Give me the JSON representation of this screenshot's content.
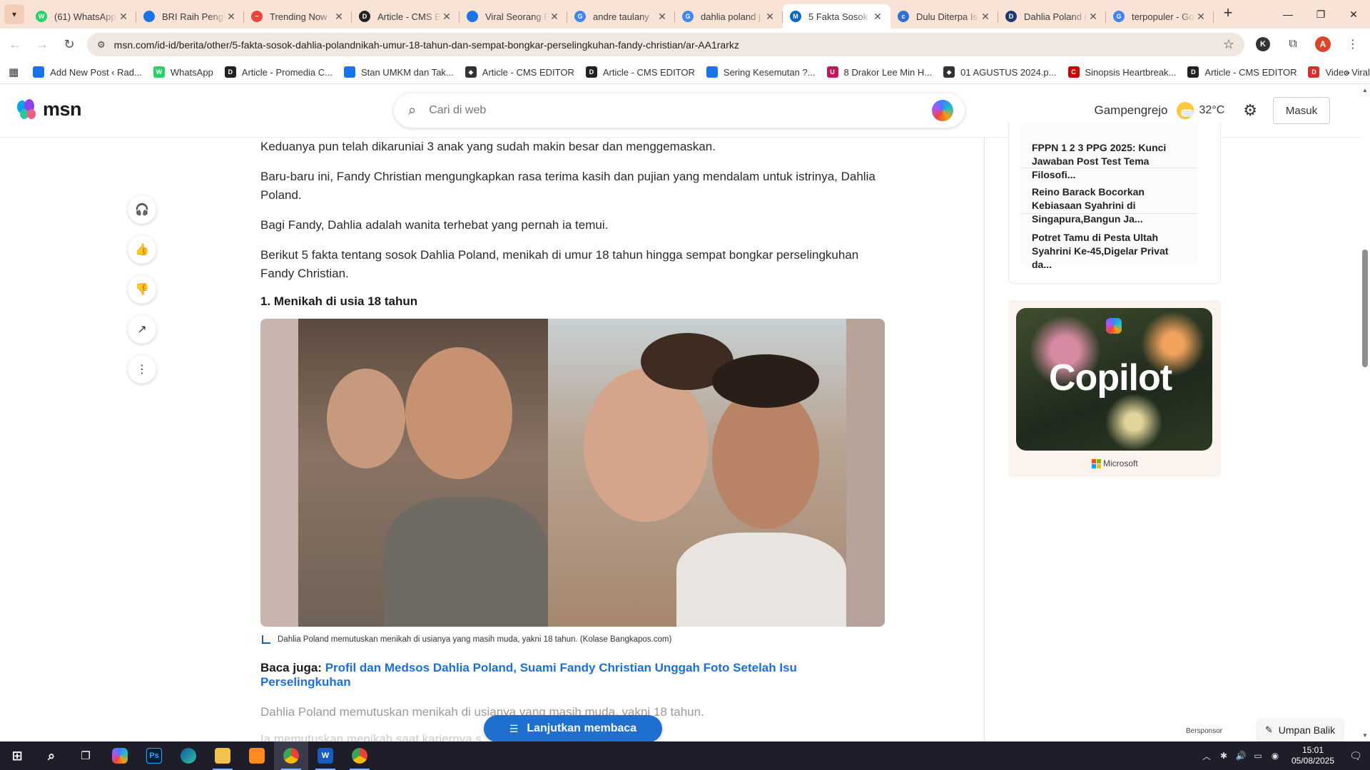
{
  "browser": {
    "tabs": [
      {
        "title": "(61) WhatsApp",
        "icon": "whatsapp-icon",
        "color": "#25d366",
        "glyph": "W"
      },
      {
        "title": "BRI Raih Pengh",
        "icon": "bookmark-icon",
        "color": "#1a73e8",
        "glyph": ""
      },
      {
        "title": "Trending Now",
        "icon": "trending-icon",
        "color": "#e8453c",
        "glyph": "~"
      },
      {
        "title": "Article - CMS E",
        "icon": "cms-icon",
        "color": "#222222",
        "glyph": "D"
      },
      {
        "title": "Viral Seorang P",
        "icon": "bookmark-icon",
        "color": "#1a73e8",
        "glyph": ""
      },
      {
        "title": "andre taulany",
        "icon": "google-icon",
        "color": "#4285f4",
        "glyph": "G"
      },
      {
        "title": "dahlia poland j",
        "icon": "google-icon",
        "color": "#4285f4",
        "glyph": "G"
      },
      {
        "title": "5 Fakta Sosok D",
        "icon": "msn-icon",
        "color": "#0a66c2",
        "glyph": "M"
      },
      {
        "title": "Dulu Diterpa Is",
        "icon": "cloud-icon",
        "color": "#2f6fd6",
        "glyph": "c"
      },
      {
        "title": "Dahlia Poland C",
        "icon": "dahlia-icon",
        "color": "#1c3a6b",
        "glyph": "D"
      },
      {
        "title": "terpopuler - Go",
        "icon": "google-icon",
        "color": "#4285f4",
        "glyph": "G"
      }
    ],
    "active_tab": 7,
    "url": "msn.com/id-id/berita/other/5-fakta-sosok-dahlia-polandnikah-umur-18-tahun-dan-sempat-bongkar-perselingkuhan-fandy-christian/ar-AA1rarkz",
    "profile_initial": "A",
    "extension_initial": "K",
    "bookmarks": [
      {
        "label": "Add New Post ‹ Rad...",
        "color": "#1a73e8",
        "glyph": ""
      },
      {
        "label": "WhatsApp",
        "color": "#25d366",
        "glyph": "W"
      },
      {
        "label": "Article - Promedia C...",
        "color": "#222222",
        "glyph": "D"
      },
      {
        "label": "Stan UMKM dan Tak...",
        "color": "#1a73e8",
        "glyph": ""
      },
      {
        "label": "Article - CMS EDITOR",
        "color": "#333333",
        "glyph": "◆"
      },
      {
        "label": "Article - CMS EDITOR",
        "color": "#222222",
        "glyph": "D"
      },
      {
        "label": "Sering Kesemutan ?...",
        "color": "#1a73e8",
        "glyph": ""
      },
      {
        "label": "8 Drakor Lee Min H...",
        "color": "#c2185b",
        "glyph": "U"
      },
      {
        "label": "01 AGUSTUS 2024.p...",
        "color": "#333333",
        "glyph": "◆"
      },
      {
        "label": "Sinopsis Heartbreak...",
        "color": "#cc0000",
        "glyph": "C"
      },
      {
        "label": "Article - CMS EDITOR",
        "color": "#222222",
        "glyph": "D"
      },
      {
        "label": "Video Viral Erin Bug...",
        "color": "#d32f2f",
        "glyph": "D"
      }
    ]
  },
  "msn": {
    "logo": "msn",
    "search_placeholder": "Cari di web",
    "location": "Gampengrejo",
    "temperature": "32°C",
    "signin_label": "Masuk"
  },
  "article": {
    "paragraphs": [
      "Keduanya pun telah dikaruniai 3 anak yang sudah makin besar dan menggemaskan.",
      "Baru-baru ini, Fandy Christian mengungkapkan rasa terima kasih dan pujian yang mendalam untuk istrinya, Dahlia Poland.",
      "Bagi Fandy, Dahlia adalah wanita terhebat yang pernah ia temui.",
      "Berikut 5 fakta tentang sosok Dahlia Poland, menikah di umur 18 tahun hingga sempat bongkar perselingkuhan Fandy Christian."
    ],
    "heading": "1. Menikah di usia 18 tahun",
    "caption": "Dahlia Poland memutuskan menikah di usianya yang masih muda, yakni 18 tahun. (Kolase Bangkapos.com)",
    "read_also_prefix": "Baca juga:",
    "read_also_link": "Profil dan Medsos Dahlia Poland, Suami Fandy Christian Unggah Foto Setelah Isu Perselingkuhan",
    "muted_paragraph": "Dahlia Poland memutuskan menikah di usianya yang masih muda, yakni 18 tahun.",
    "faded_paragraph": "Ia memutuskan menikah saat kariernya s",
    "continue_label": "Lanjutkan membaca"
  },
  "sidebar": {
    "trending": [
      "FPPN 1 2 3 PPG 2025: Kunci Jawaban Post Test Tema Filosofi...",
      "Reino Barack Bocorkan Kebiasaan Syahrini di Singapura,Bangun Ja...",
      "Potret Tamu di Pesta Ultah Syahrini Ke-45,Digelar Privat da..."
    ],
    "ad_title": "Copilot",
    "ad_brand": "Microsoft",
    "sponsor_label": "Bersponsor",
    "feedback_label": "Umpan Balik"
  },
  "taskbar": {
    "time": "15:01",
    "date": "05/08/2025"
  }
}
